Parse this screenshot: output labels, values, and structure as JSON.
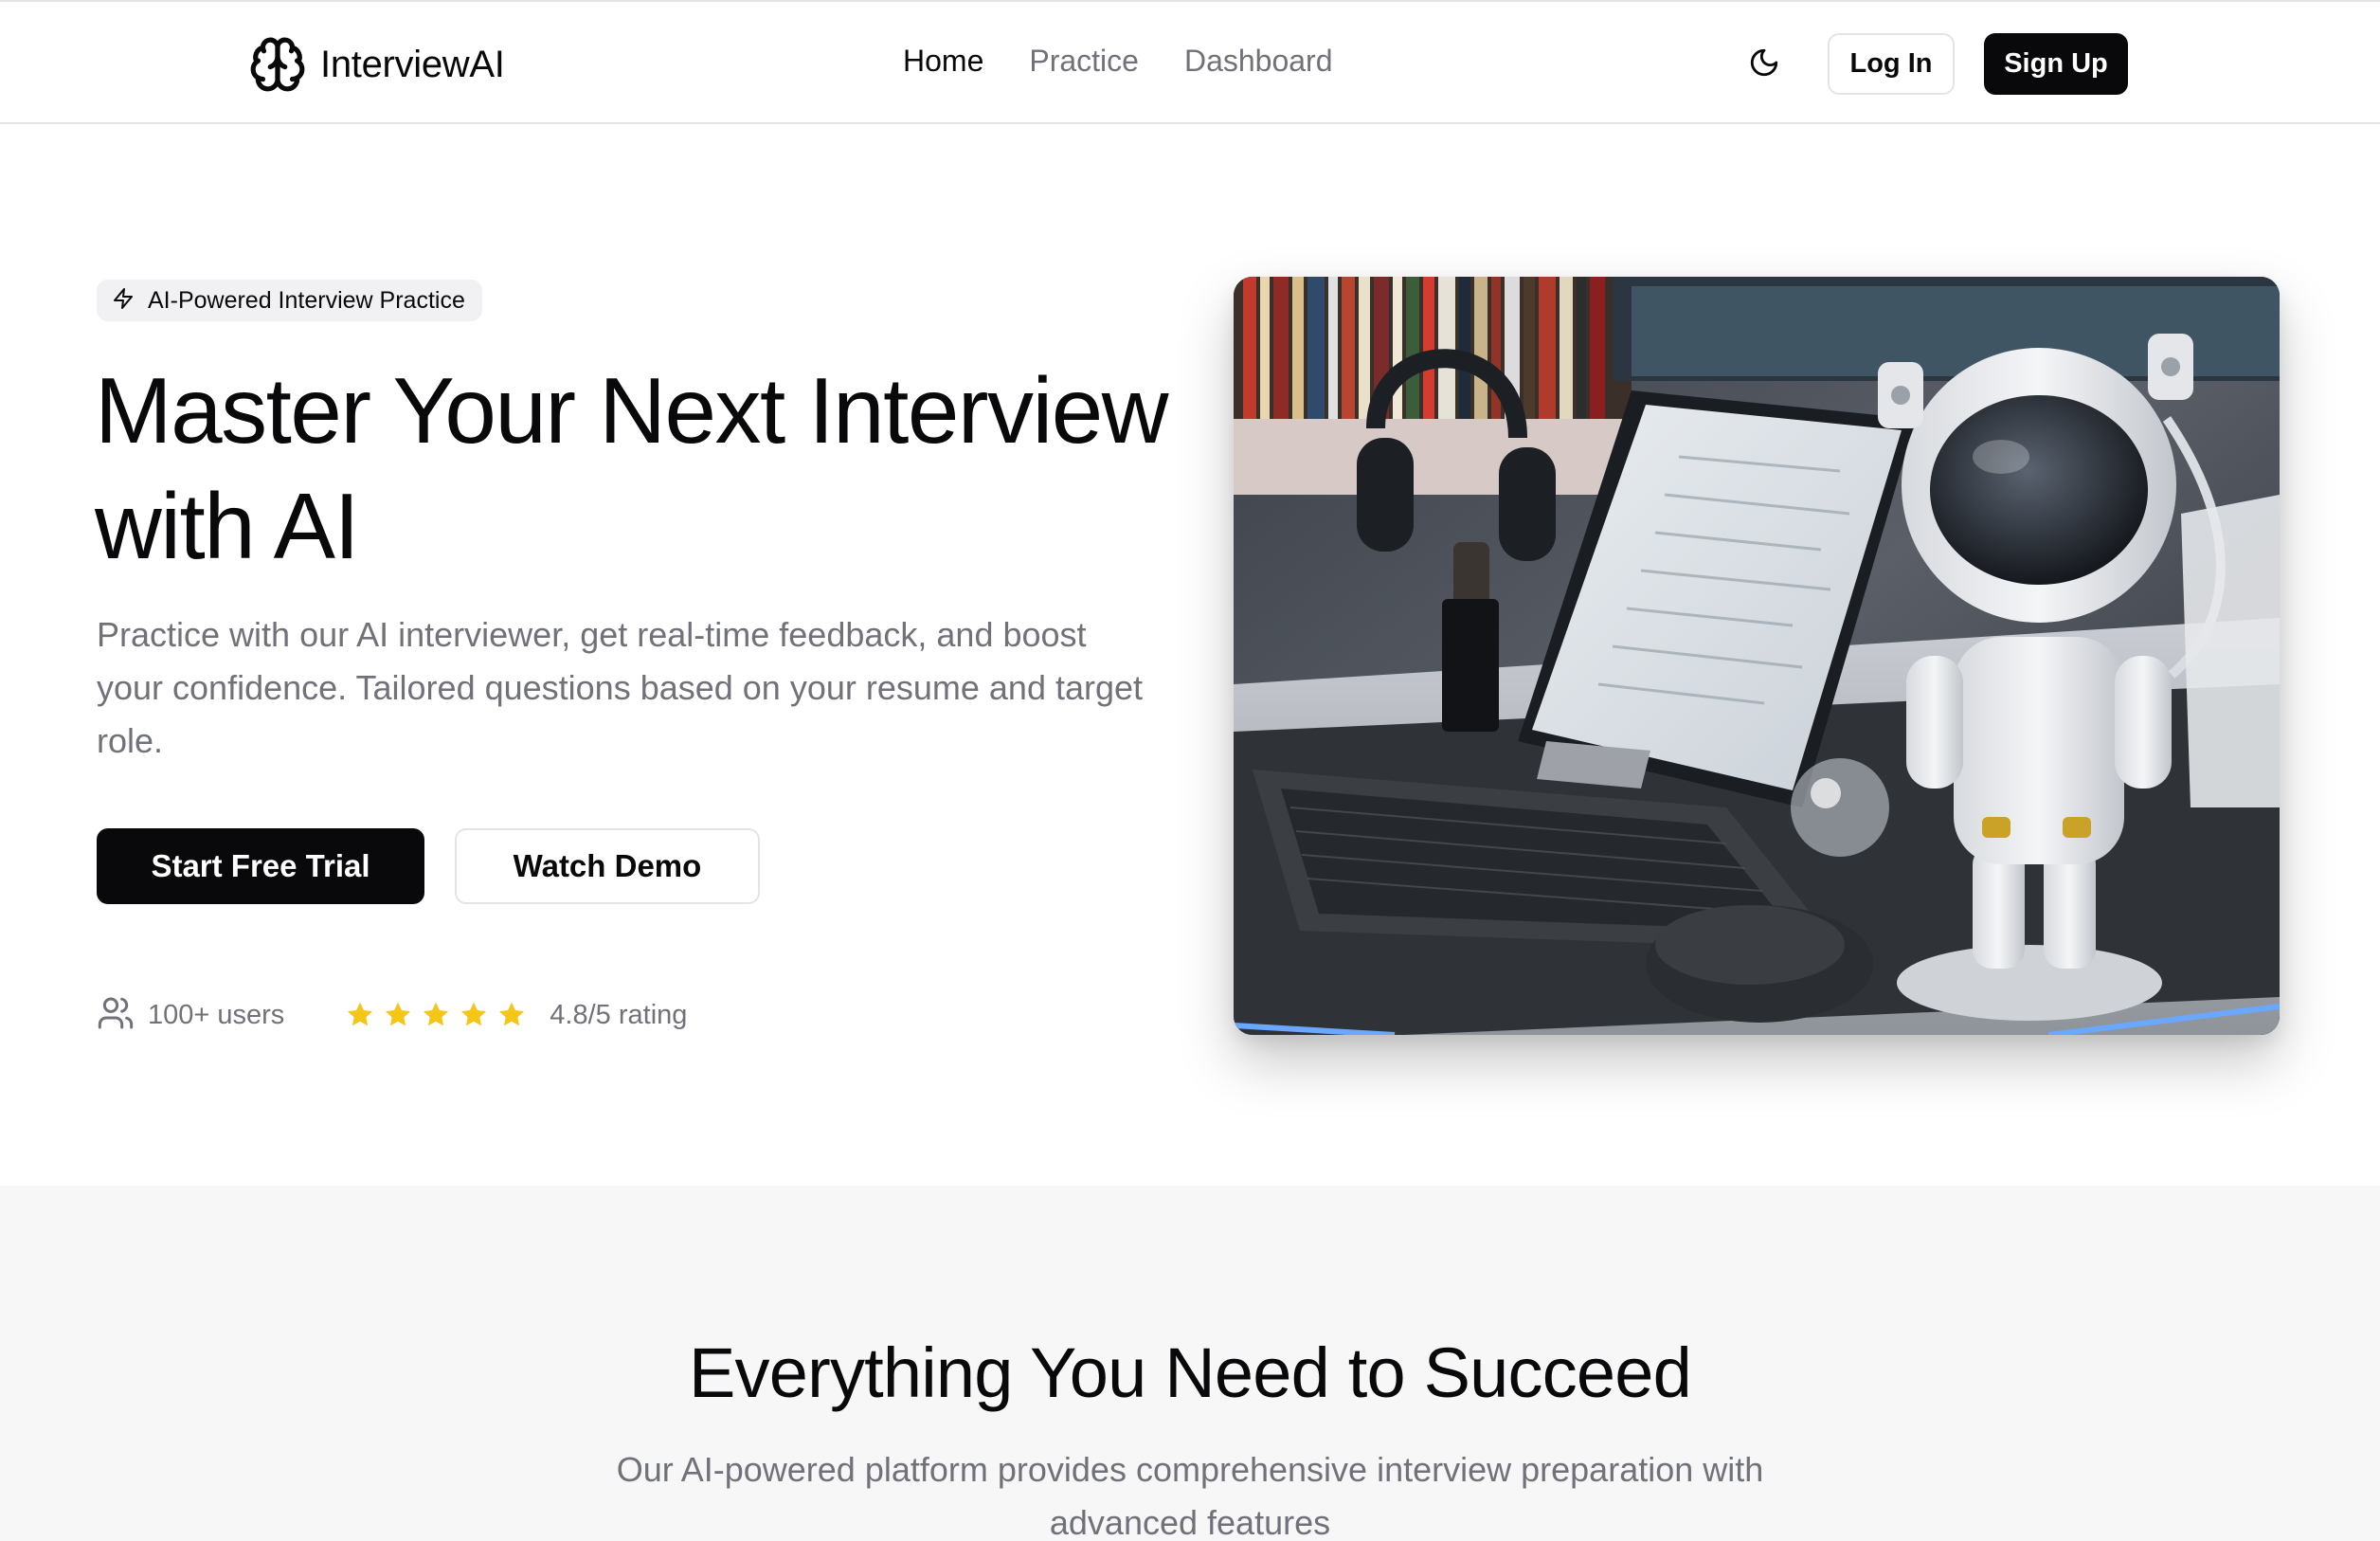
{
  "header": {
    "brand_name": "InterviewAI",
    "nav": [
      {
        "label": "Home",
        "active": true
      },
      {
        "label": "Practice",
        "active": false
      },
      {
        "label": "Dashboard",
        "active": false
      }
    ],
    "theme_toggle_icon": "moon-icon",
    "login_label": "Log In",
    "signup_label": "Sign Up"
  },
  "hero": {
    "badge_icon": "lightning-icon",
    "badge_text": "AI-Powered Interview Practice",
    "title_line1": "Master Your Next Interview",
    "title_line2": "with AI",
    "subtitle": "Practice with our AI interviewer, get real-time feedback, and boost your confidence. Tailored questions based on your resume and target role.",
    "primary_cta": "Start Free Trial",
    "secondary_cta": "Watch Demo",
    "users_icon": "users-icon",
    "users_text": "100+ users",
    "star_count": 5,
    "rating_text": "4.8/5 rating"
  },
  "features": {
    "title": "Everything You Need to Succeed",
    "subtitle": "Our AI-powered platform provides comprehensive interview preparation with advanced features"
  },
  "colors": {
    "primary": "#09090b",
    "muted_text": "#71717a",
    "border": "#e4e4e7",
    "star": "#f5c518",
    "section_bg": "#f7f7f8"
  }
}
